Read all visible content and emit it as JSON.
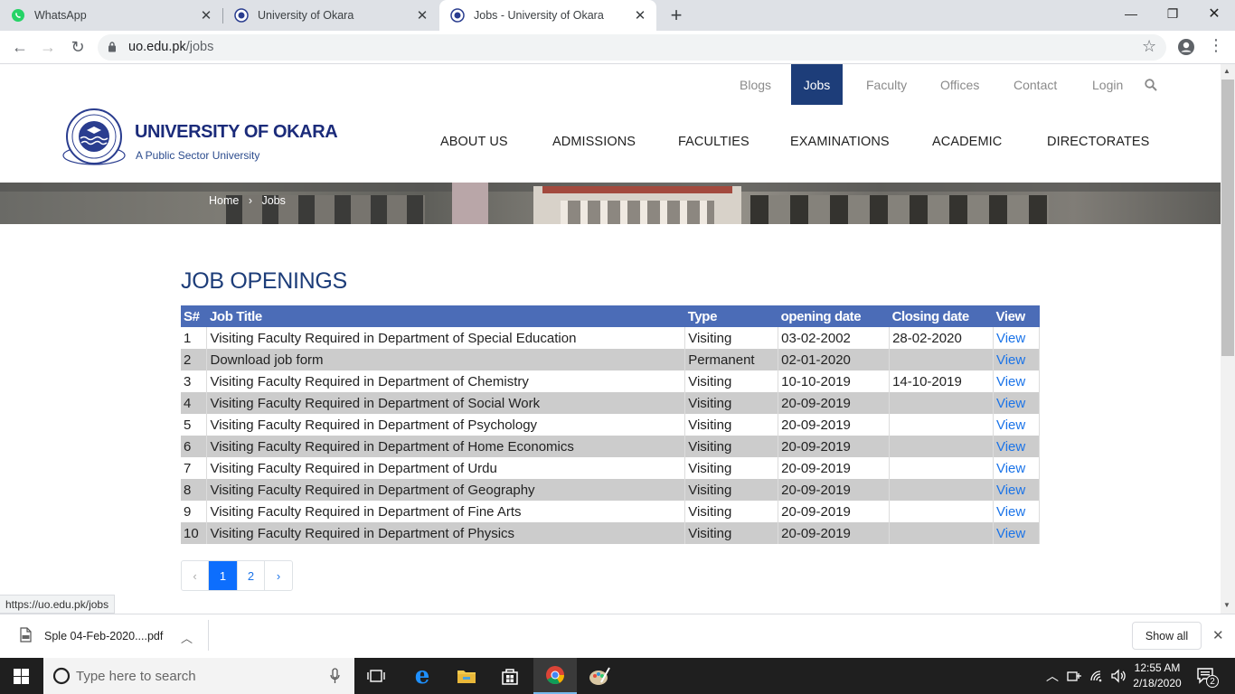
{
  "browser": {
    "tabs": [
      {
        "title": "WhatsApp",
        "icon": "whatsapp-icon"
      },
      {
        "title": "University of Okara",
        "icon": "uo-favicon-icon"
      },
      {
        "title": "Jobs - University of Okara",
        "icon": "uo-favicon-icon",
        "active": true
      }
    ],
    "url_domain": "uo.edu.pk",
    "url_path": "/jobs",
    "status_url": "https://uo.edu.pk/jobs"
  },
  "site": {
    "top_links": [
      "Blogs",
      "Jobs",
      "Faculty",
      "Offices",
      "Contact",
      "Login"
    ],
    "active_top_link": "Jobs",
    "university_name": "UNIVERSITY OF OKARA",
    "tagline": "A Public Sector University",
    "main_nav": [
      "ABOUT US",
      "ADMISSIONS",
      "FACULTIES",
      "EXAMINATIONS",
      "ACADEMIC",
      "DIRECTORATES"
    ],
    "breadcrumb": {
      "home": "Home",
      "sep": "›",
      "current": "Jobs"
    },
    "page_title": "JOB OPENINGS",
    "table": {
      "headers": [
        "S#",
        "Job Title",
        "Type",
        "opening date",
        "Closing date",
        "View"
      ],
      "rows": [
        [
          "1",
          "Visiting Faculty Required in Department of Special Education",
          "Visiting",
          "03-02-2002",
          "28-02-2020",
          "View"
        ],
        [
          "2",
          "Download job form",
          "Permanent",
          "02-01-2020",
          "",
          "View"
        ],
        [
          "3",
          "Visiting Faculty Required in Department of Chemistry",
          "Visiting",
          "10-10-2019",
          "14-10-2019",
          "View"
        ],
        [
          "4",
          "Visiting Faculty Required in Department of Social Work",
          "Visiting",
          "20-09-2019",
          "",
          "View"
        ],
        [
          "5",
          "Visiting Faculty Required in Department of Psychology",
          "Visiting",
          "20-09-2019",
          "",
          "View"
        ],
        [
          "6",
          "Visiting Faculty Required in Department of Home Economics",
          "Visiting",
          "20-09-2019",
          "",
          "View"
        ],
        [
          "7",
          "Visiting Faculty Required in Department of Urdu",
          "Visiting",
          "20-09-2019",
          "",
          "View"
        ],
        [
          "8",
          "Visiting Faculty Required in Department of Geography",
          "Visiting",
          "20-09-2019",
          "",
          "View"
        ],
        [
          "9",
          "Visiting Faculty Required in Department of Fine Arts",
          "Visiting",
          "20-09-2019",
          "",
          "View"
        ],
        [
          "10",
          "Visiting Faculty Required in Department of Physics",
          "Visiting",
          "20-09-2019",
          "",
          "View"
        ]
      ]
    },
    "pagination": {
      "prev": "‹",
      "pages": [
        "1",
        "2"
      ],
      "current": "1",
      "next": "›"
    }
  },
  "downloads": {
    "file_name": "Sple 04-Feb-2020....pdf",
    "show_all": "Show all"
  },
  "taskbar": {
    "search_placeholder": "Type here to search",
    "time": "12:55 AM",
    "date": "2/18/2020",
    "notifications": "2"
  },
  "colors": {
    "brand_blue": "#1d3d79",
    "table_header": "#4b6cb7",
    "row_alt": "#cccccc",
    "link": "#1a73e8",
    "pager_active": "#0d6efd"
  }
}
